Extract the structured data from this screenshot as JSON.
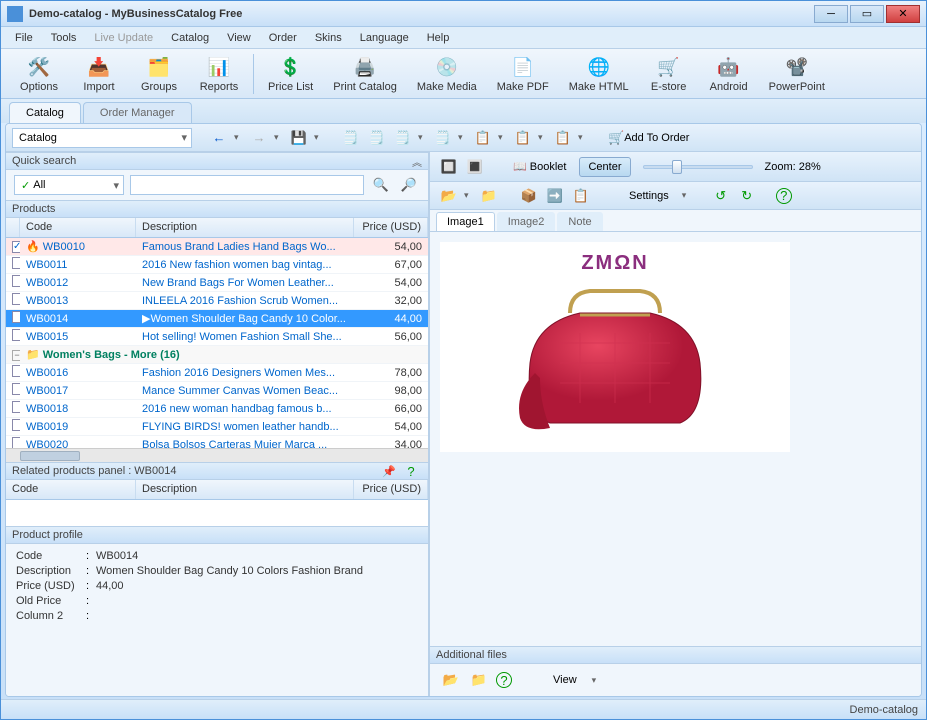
{
  "window": {
    "title": "Demo-catalog - MyBusinessCatalog Free"
  },
  "menu": [
    "File",
    "Tools",
    "Live Update",
    "Catalog",
    "View",
    "Order",
    "Skins",
    "Language",
    "Help"
  ],
  "menu_disabled_index": 2,
  "toolbar": [
    {
      "label": "Options",
      "icon": "🛠️"
    },
    {
      "label": "Import",
      "icon": "📥"
    },
    {
      "label": "Groups",
      "icon": "🗂️"
    },
    {
      "label": "Reports",
      "icon": "📊"
    },
    {
      "label": "Price List",
      "icon": "💲"
    },
    {
      "label": "Print Catalog",
      "icon": "🖨️"
    },
    {
      "label": "Make Media",
      "icon": "💿"
    },
    {
      "label": "Make PDF",
      "icon": "📄"
    },
    {
      "label": "Make HTML",
      "icon": "🌐"
    },
    {
      "label": "E-store",
      "icon": "🛒"
    },
    {
      "label": "Android",
      "icon": "🤖"
    },
    {
      "label": "PowerPoint",
      "icon": "📽️"
    }
  ],
  "main_tabs": {
    "active": "Catalog",
    "inactive": "Order Manager"
  },
  "catalog_combo": "Catalog",
  "add_to_order": "Add To Order",
  "quick_search": {
    "title": "Quick search",
    "filter": "All"
  },
  "products": {
    "title": "Products",
    "headers": {
      "code": "Code",
      "desc": "Description",
      "price": "Price (USD)"
    },
    "rows": [
      {
        "chk": true,
        "hot": true,
        "code": "WB0010",
        "desc": "Famous Brand Ladies Hand Bags Wo...",
        "price": "54,00"
      },
      {
        "code": "WB0011",
        "desc": "2016 New fashion women bag vintag...",
        "price": "67,00"
      },
      {
        "code": "WB0012",
        "desc": "New Brand Bags For Women Leather...",
        "price": "54,00"
      },
      {
        "code": "WB0013",
        "desc": "INLEELA 2016 Fashion Scrub Women...",
        "price": "32,00"
      },
      {
        "sel": true,
        "code": "WB0014",
        "desc": "Women Shoulder Bag Candy 10 Color...",
        "price": "44,00"
      },
      {
        "code": "WB0015",
        "desc": "Hot selling! Women Fashion Small She...",
        "price": "56,00"
      },
      {
        "group": true,
        "code": "Women's Bags - More  (16)",
        "desc": "",
        "price": ""
      },
      {
        "code": "WB0016",
        "desc": "Fashion 2016 Designers Women Mes...",
        "price": "78,00"
      },
      {
        "code": "WB0017",
        "desc": "Mance Summer Canvas Women Beac...",
        "price": "98,00"
      },
      {
        "code": "WB0018",
        "desc": "2016 new woman handbag famous b...",
        "price": "66,00"
      },
      {
        "code": "WB0019",
        "desc": "FLYING BIRDS! women leather handb...",
        "price": "54,00"
      },
      {
        "code": "WB0020",
        "desc": "Bolsa Bolsos Carteras Mujer Marca ...",
        "price": "34,00"
      }
    ]
  },
  "related": {
    "title": "Related products panel : WB0014",
    "headers": {
      "code": "Code",
      "desc": "Description",
      "price": "Price (USD)"
    }
  },
  "profile": {
    "title": "Product profile",
    "rows": [
      {
        "label": "Code",
        "value": "WB0014"
      },
      {
        "label": "Description",
        "value": "Women Shoulder Bag Candy 10 Colors Fashion Brand"
      },
      {
        "label": "Price (USD)",
        "value": "44,00"
      },
      {
        "label": "Old Price",
        "value": ""
      },
      {
        "label": "Column 2",
        "value": ""
      }
    ]
  },
  "preview": {
    "booklet": "Booklet",
    "center": "Center",
    "zoom": "Zoom: 28%",
    "settings": "Settings",
    "tabs": [
      "Image1",
      "Image2",
      "Note"
    ],
    "brand": "ZMΩN"
  },
  "addfiles": {
    "title": "Additional files",
    "view": "View"
  },
  "status": "Demo-catalog"
}
